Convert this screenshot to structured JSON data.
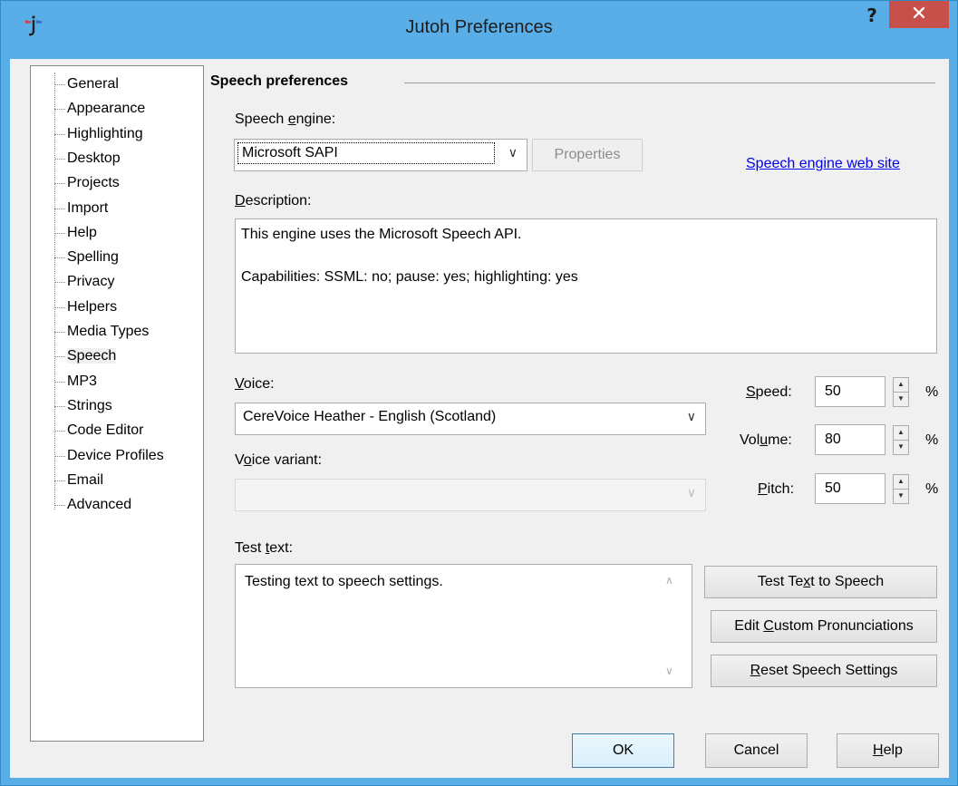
{
  "window": {
    "title": "Jutoh Preferences",
    "help_label": "?",
    "close_label": "✕"
  },
  "nav": {
    "items": [
      {
        "label": "General"
      },
      {
        "label": "Appearance"
      },
      {
        "label": "Highlighting"
      },
      {
        "label": "Desktop"
      },
      {
        "label": "Projects"
      },
      {
        "label": "Import"
      },
      {
        "label": "Help"
      },
      {
        "label": "Spelling"
      },
      {
        "label": "Privacy"
      },
      {
        "label": "Helpers"
      },
      {
        "label": "Media Types"
      },
      {
        "label": "Speech",
        "selected": true
      },
      {
        "label": "MP3"
      },
      {
        "label": "Strings"
      },
      {
        "label": "Code Editor"
      },
      {
        "label": "Device Profiles"
      },
      {
        "label": "Email"
      },
      {
        "label": "Advanced"
      }
    ]
  },
  "speech": {
    "group_title": "Speech preferences",
    "engine_label_pre": "Speech ",
    "engine_label_key": "e",
    "engine_label_post": "ngine:",
    "engine_value": "Microsoft SAPI",
    "properties_label": "Properties",
    "website_link": "Speech engine web site",
    "description_label_key": "D",
    "description_label_post": "escription:",
    "description_line1": "This engine uses the Microsoft Speech API.",
    "description_line2": "Capabilities: SSML: no; pause: yes; highlighting: yes",
    "voice_label_key": "V",
    "voice_label_post": "oice:",
    "voice_value": "CereVoice Heather - English (Scotland)",
    "variant_label_pre": "V",
    "variant_label_key": "o",
    "variant_label_post": "ice variant:",
    "variant_value": "",
    "speed_label_key": "S",
    "speed_label_post": "peed:",
    "speed_value": "50",
    "volume_label_pre": "Vol",
    "volume_label_key": "u",
    "volume_label_post": "me:",
    "volume_value": "80",
    "pitch_label_key": "P",
    "pitch_label_post": "itch:",
    "pitch_value": "50",
    "percent": "%",
    "test_label_pre": "Test ",
    "test_label_key": "t",
    "test_label_post": "ext:",
    "test_text": "Testing text to speech settings.",
    "test_btn_pre": "Test Te",
    "test_btn_key": "x",
    "test_btn_post": "t to Speech",
    "custom_btn_pre": "Edit ",
    "custom_btn_key": "C",
    "custom_btn_post": "ustom Pronunciations",
    "reset_btn_key": "R",
    "reset_btn_post": "eset Speech Settings"
  },
  "footer": {
    "ok_label": "OK",
    "cancel_label": "Cancel",
    "help_key": "H",
    "help_post": "elp"
  }
}
